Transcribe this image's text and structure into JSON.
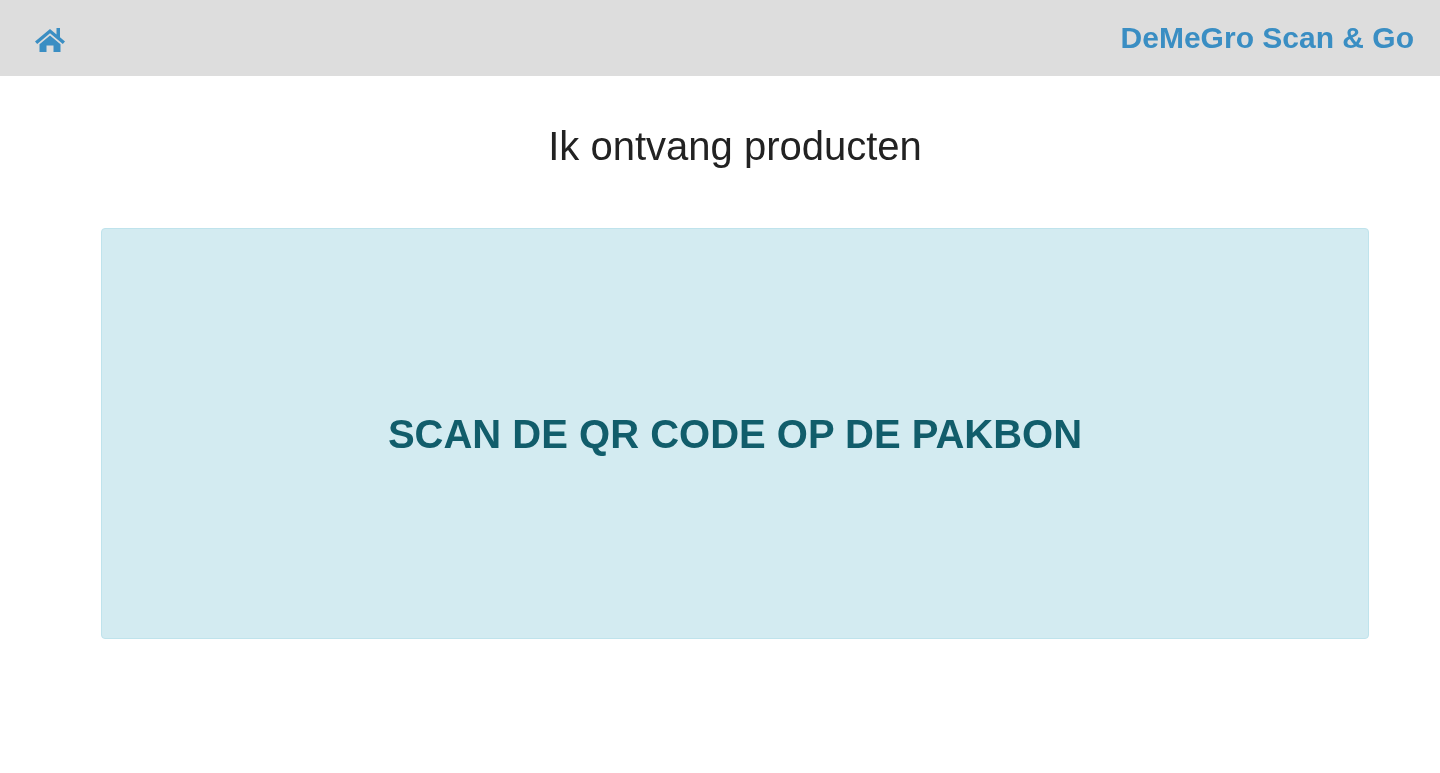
{
  "header": {
    "title": "DeMeGro Scan & Go"
  },
  "heading": "Ik ontvang producten",
  "notice": {
    "message": "SCAN DE QR CODE OP DE PAKBON"
  }
}
